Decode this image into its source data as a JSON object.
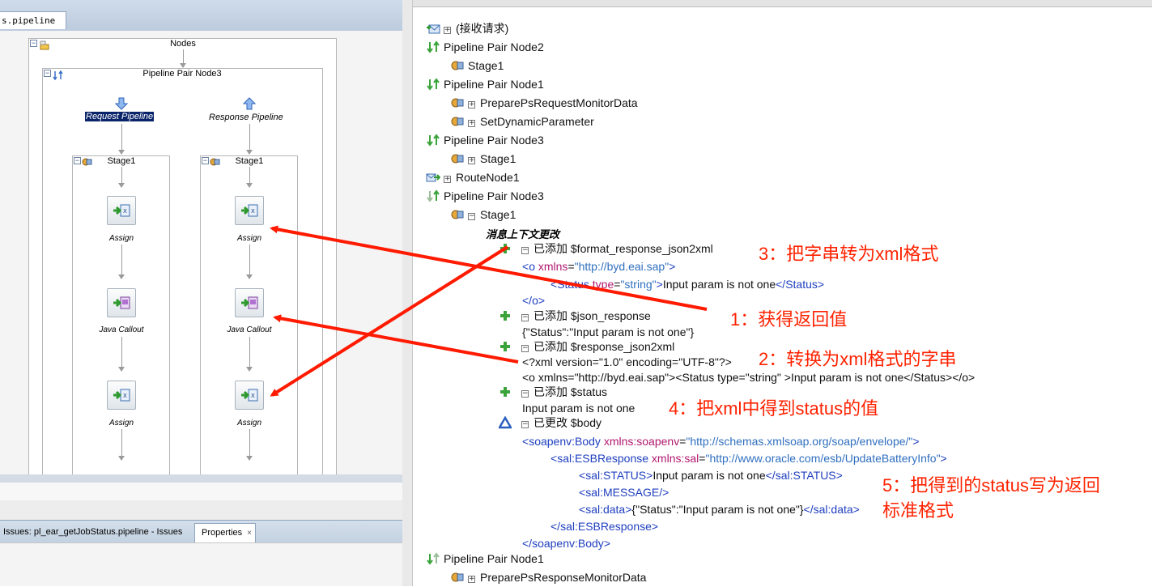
{
  "left": {
    "editor_tab": "s.pipeline",
    "nodes_label": "Nodes",
    "pipeline_pair_label": "Pipeline Pair Node3",
    "request_pipeline": "Request Pipeline",
    "response_pipeline": "Response Pipeline",
    "stage_req": "Stage1",
    "stage_resp": "Stage1",
    "actions_req": [
      "Assign",
      "Java Callout",
      "Assign"
    ],
    "actions_resp": [
      "Assign",
      "Java Callout",
      "Assign"
    ],
    "bottom_tab_issues": "Issues: pl_ear_getJobStatus.pipeline - Issues",
    "bottom_tab_properties": "Properties",
    "close_glyph": "×"
  },
  "tree": {
    "receive": "(接收请求)",
    "pp_node2": "Pipeline Pair Node2",
    "stage1_a": "Stage1",
    "pp_node1": "Pipeline Pair Node1",
    "prepare_req": "PreparePsRequestMonitorData",
    "set_dynamic": "SetDynamicParameter",
    "pp_node3_a": "Pipeline Pair Node3",
    "stage1_b": "Stage1",
    "route_node": "RouteNode1",
    "pp_node3_b": "Pipeline Pair Node3",
    "stage1_c": "Stage1",
    "ctx_change": "消息上下文更改",
    "added_format": "已添加 $format_response_json2xml",
    "added_json": "已添加 $json_response",
    "json_value": "{\"Status\":\"Input param is not one\"}",
    "added_resp_xml": "已添加 $response_json2xml",
    "xml_decl": "<?xml version=\"1.0\" encoding=\"UTF-8\"?>",
    "xml_inline": "<o xmlns=\"http://byd.eai.sap\"><Status type=\"string\" >Input param is not one</Status></o>",
    "added_status": "已添加 $status",
    "status_value": "Input param is not one",
    "changed_body": "已更改 $body",
    "pp_node1_b": "Pipeline Pair Node1",
    "prepare_resp": "PreparePsResponseMonitorData"
  },
  "xml": {
    "o_open_lt": "<",
    "o_tag": "o",
    "xmlns_attr": "xmlns",
    "eq": "=",
    "byd_ns": "\"http://byd.eai.sap\"",
    "gt": ">",
    "status_tag": "Status",
    "type_attr": "type",
    "string_val": "\"string\"",
    "status_text": "Input param is not one",
    "close_lt": "</",
    "soap_body_tag": "soapenv:Body",
    "soap_ns_attr": "xmlns:soapenv",
    "soap_ns": "\"http://schemas.xmlsoap.org/soap/envelope/\"",
    "esb_tag": "sal:ESBResponse",
    "sal_ns_attr": "xmlns:sal",
    "sal_ns": "\"http://www.oracle.com/esb/UpdateBatteryInfo\"",
    "sal_status": "sal:STATUS",
    "sal_message": "sal:MESSAGE",
    "self_close": "/>",
    "sal_data": "sal:data",
    "data_text": "{\"Status\":\"Input param is not one\"}"
  },
  "annotations": {
    "a1": "1：获得返回值",
    "a2": "2：转换为xml格式的字串",
    "a3": "3：把字串转为xml格式",
    "a4": "4：把xml中得到status的值",
    "a5_line1": "5：把得到的status写为返回",
    "a5_line2": "标准格式"
  },
  "colors": {
    "annotation_red": "#ff2200",
    "xml_tag_blue": "#1f3fbf",
    "xml_attr_magenta": "#b0186f",
    "added_green": "#3aa33a",
    "changed_blue": "#2b5fbf"
  }
}
